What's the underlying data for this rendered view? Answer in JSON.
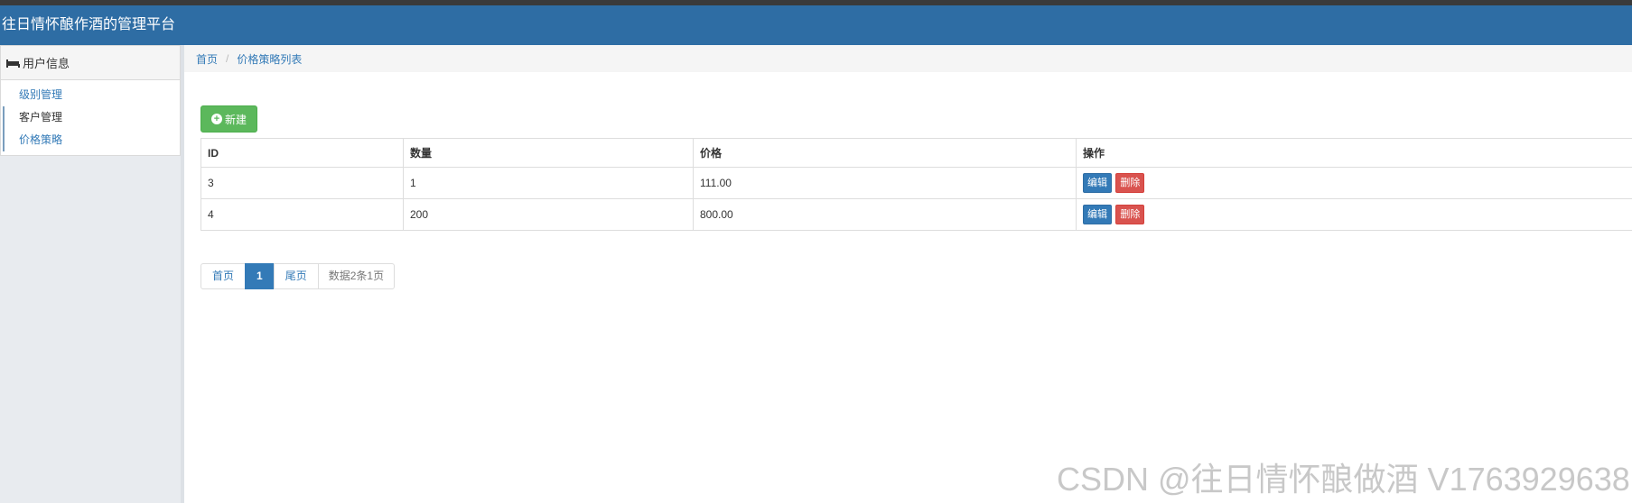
{
  "header": {
    "title": "往日情怀酿作酒的管理平台"
  },
  "sidebar": {
    "panel_title": "用户信息",
    "items": [
      {
        "label": "级别管理"
      },
      {
        "label": "客户管理"
      },
      {
        "label": "价格策略"
      }
    ]
  },
  "breadcrumb": {
    "home": "首页",
    "separator": "/",
    "current": "价格策略列表"
  },
  "toolbar": {
    "new_label": "新建"
  },
  "table": {
    "headers": [
      "ID",
      "数量",
      "价格",
      "操作"
    ],
    "rows": [
      {
        "id": "3",
        "quantity": "1",
        "price": "111.00",
        "edit": "编辑",
        "delete": "删除"
      },
      {
        "id": "4",
        "quantity": "200",
        "price": "800.00",
        "edit": "编辑",
        "delete": "删除"
      }
    ]
  },
  "pagination": {
    "first": "首页",
    "current": "1",
    "last": "尾页",
    "info": "数据2条1页"
  },
  "watermark": "CSDN @往日情怀酿做酒 V1763929638",
  "colors": {
    "header": "#2e6da4",
    "success": "#5cb85c",
    "primary": "#337ab7",
    "danger": "#d9534f"
  }
}
